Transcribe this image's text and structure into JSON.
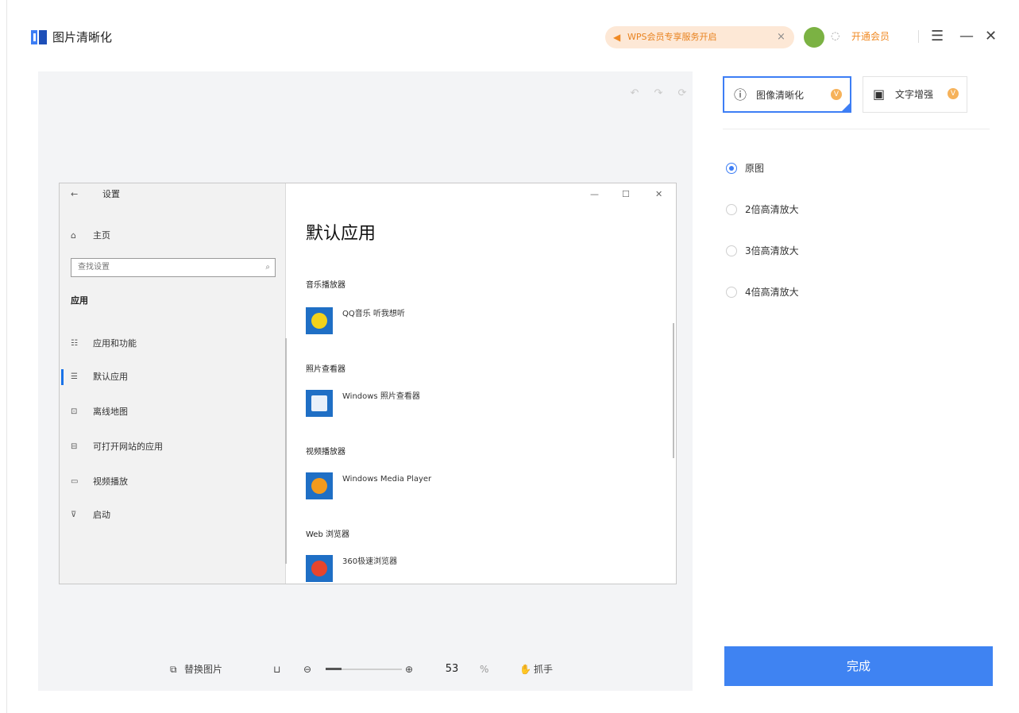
{
  "titlebar": {
    "app_title": "图片清晰化",
    "promo_text": "WPS会员专享服务开启",
    "promo_close": "×",
    "vip_link": "开通会员",
    "menu_glyph": "☰",
    "min_glyph": "—",
    "close_glyph": "✕"
  },
  "canvas": {
    "toolbar_icons": [
      "undo-icon",
      "redo-icon",
      "reset-icon"
    ]
  },
  "embedded_screenshot": {
    "window_title": "设置",
    "back_glyph": "←",
    "home_label": "主页",
    "search_placeholder": "查找设置",
    "section_label": "应用",
    "nav_items": [
      {
        "icon": "☷",
        "label": "应用和功能"
      },
      {
        "icon": "☰",
        "label": "默认应用"
      },
      {
        "icon": "⊡",
        "label": "离线地图"
      },
      {
        "icon": "⊟",
        "label": "可打开网站的应用"
      },
      {
        "icon": "▭",
        "label": "视频播放"
      },
      {
        "icon": "⊽",
        "label": "启动"
      }
    ],
    "page_title": "默认应用",
    "categories": [
      {
        "title": "音乐播放器",
        "app": "QQ音乐 听我想听"
      },
      {
        "title": "照片查看器",
        "app": "Windows 照片查看器"
      },
      {
        "title": "视频播放器",
        "app": "Windows Media Player"
      },
      {
        "title": "Web 浏览器",
        "app": "360极速浏览器"
      }
    ],
    "win_min": "—",
    "win_max": "☐",
    "win_close": "✕"
  },
  "bottom_toolbar": {
    "replace_label": "替换图片",
    "zoom_value": "53",
    "zoom_unit": "%",
    "zoom_fraction": 0.53,
    "hand_label": "抓手"
  },
  "right_panel": {
    "tabs": [
      {
        "label": "图像清晰化",
        "icon": "ⓘ",
        "active": true
      },
      {
        "label": "文字增强",
        "icon": "▣",
        "active": false
      }
    ],
    "options": [
      {
        "label": "原图",
        "selected": true
      },
      {
        "label": "2倍高清放大",
        "selected": false
      },
      {
        "label": "3倍高清放大",
        "selected": false
      },
      {
        "label": "4倍高清放大",
        "selected": false
      }
    ],
    "done_label": "完成"
  },
  "colors": {
    "accent": "#3f83f2",
    "promo_bg": "#fde8d6",
    "promo_text": "#e8821f",
    "canvas_bg": "#f3f4f6"
  }
}
